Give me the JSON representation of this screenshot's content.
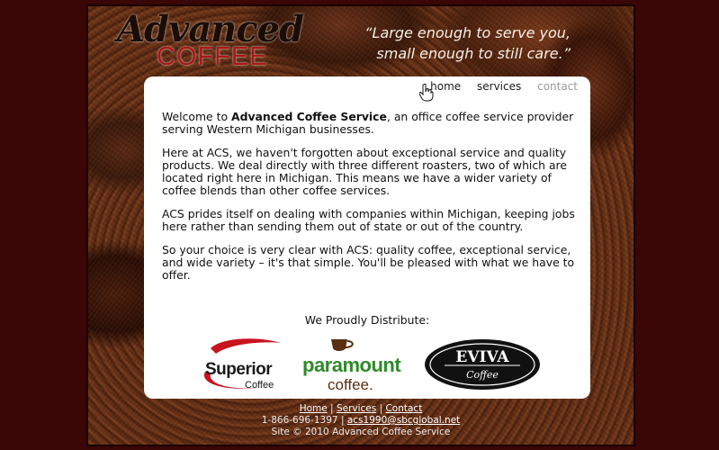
{
  "header": {
    "logo_word1": "Advanced",
    "logo_word2": "COFFEE",
    "tagline_line1": "“Large enough to serve you,",
    "tagline_line2": "small enough to still care.”"
  },
  "nav": {
    "items": [
      {
        "label": "home"
      },
      {
        "label": "services"
      },
      {
        "label": "contact"
      }
    ]
  },
  "main": {
    "intro_prefix": "Welcome to ",
    "intro_bold": "Advanced Coffee Service",
    "intro_suffix": ", an office coffee service provider serving Western Michigan businesses.",
    "para2": "Here at ACS, we haven't forgotten about exceptional service and quality products. We deal directly with three different roasters, two of which are located right here in Michigan. This means we have a wider variety of coffee blends than other coffee services.",
    "para3": "ACS prides itself on dealing with companies within Michigan, keeping jobs here rather than sending them out of state or out of the country.",
    "para4": "So your choice is very clear with ACS: quality coffee, exceptional service, and wide variety – it's that simple. You'll be pleased with what we have to offer.",
    "distribute_heading": "We Proudly Distribute:"
  },
  "brands": {
    "superior_line1": "Superior",
    "superior_line2": "Coffee",
    "paramount_line1": "paramount",
    "paramount_line2": "coffee.",
    "eviva_line1": "EVIVA",
    "eviva_line2": "Coffee"
  },
  "footer": {
    "link_home": "Home",
    "link_services": "Services",
    "link_contact": "Contact",
    "separator": "|",
    "phone": "1-866-696-1397",
    "email": "acs1990@sbcglobal.net",
    "copyright": "Site © 2010 Advanced Coffee Service"
  },
  "colors": {
    "page_bg": "#3a0606",
    "logo_red": "#a81818",
    "superior_red": "#c8141e",
    "paramount_green": "#2f8a2a",
    "paramount_brown": "#5a2e12"
  }
}
